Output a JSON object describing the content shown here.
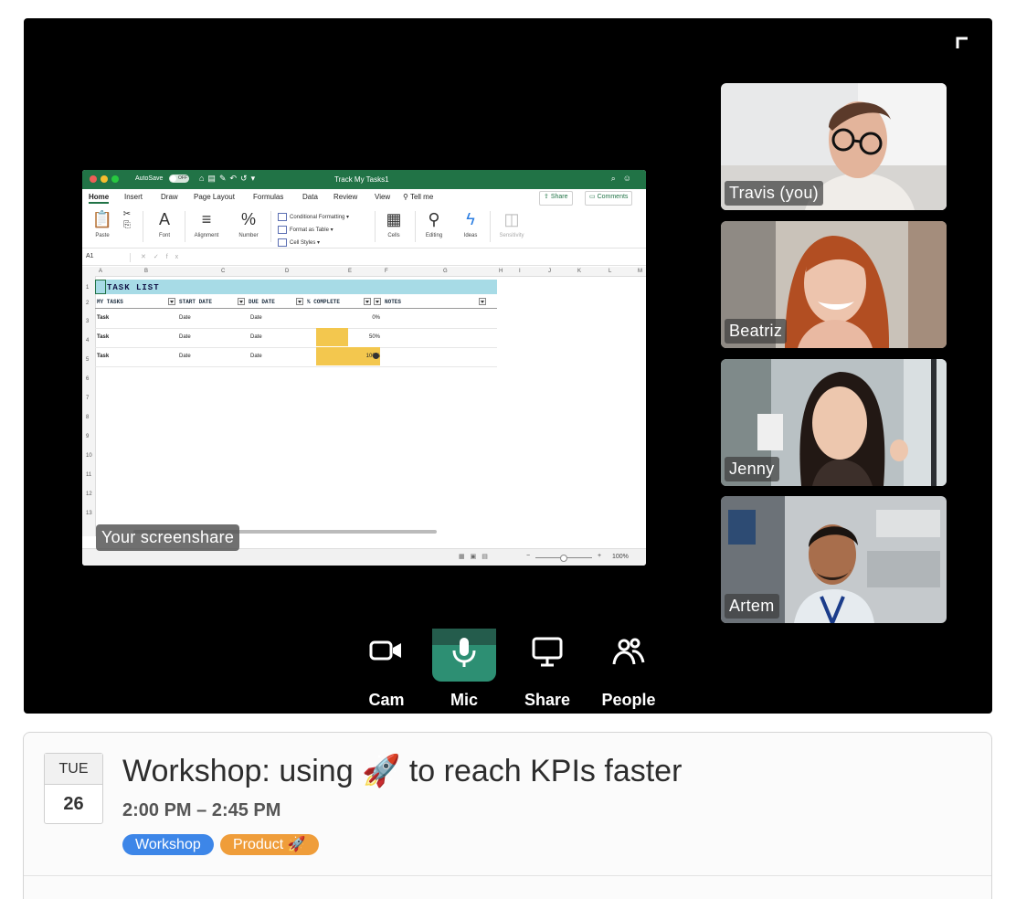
{
  "call": {
    "screenshare_label": "Your screenshare",
    "participants": [
      {
        "name": "Travis (you)"
      },
      {
        "name": "Beatriz"
      },
      {
        "name": "Jenny"
      },
      {
        "name": "Artem"
      }
    ],
    "controls": [
      {
        "label": "Cam",
        "icon": "camera-icon"
      },
      {
        "label": "Mic",
        "icon": "microphone-icon",
        "active": true
      },
      {
        "label": "Share",
        "icon": "monitor-icon"
      },
      {
        "label": "People",
        "icon": "people-icon"
      }
    ],
    "accent_color": "#2d8f73"
  },
  "excel": {
    "autosave": "AutoSave",
    "autosave_state": "OFF",
    "doc_title": "Track My Tasks1",
    "tabs": [
      "Home",
      "Insert",
      "Draw",
      "Page Layout",
      "Formulas",
      "Data",
      "Review",
      "View",
      "Tell me"
    ],
    "share_btn": "Share",
    "comments_btn": "Comments",
    "ribbon": {
      "paste": "Paste",
      "font": "Font",
      "alignment": "Alignment",
      "number": "Number",
      "conditional_formatting": "Conditional Formatting",
      "format_as_table": "Format as Table",
      "cell_styles": "Cell Styles",
      "cells": "Cells",
      "editing": "Editing",
      "ideas": "Ideas",
      "sensitivity": "Sensitivity"
    },
    "name_box": "A1",
    "columns": [
      "A",
      "B",
      "C",
      "D",
      "E",
      "F",
      "G",
      "H",
      "I",
      "J",
      "K",
      "L",
      "M"
    ],
    "rows": [
      "1",
      "2",
      "3",
      "4",
      "5",
      "6",
      "7",
      "8",
      "9",
      "10",
      "11",
      "12",
      "13"
    ],
    "sheet_title": "TASK LIST",
    "headers": [
      "MY TASKS",
      "START DATE",
      "DUE DATE",
      "% COMPLETE",
      "NOTES"
    ],
    "tasks": [
      {
        "task": "Task",
        "start": "Date",
        "due": "Date",
        "pct": "0%",
        "progress": 0
      },
      {
        "task": "Task",
        "start": "Date",
        "due": "Date",
        "pct": "50%",
        "progress": 0.5
      },
      {
        "task": "Task",
        "start": "Date",
        "due": "Date",
        "pct": "100%",
        "progress": 1.0
      }
    ],
    "zoom": "100%"
  },
  "event": {
    "dow": "TUE",
    "day": "26",
    "title": "Workshop: using 🚀 to reach KPIs faster",
    "time": "2:00 PM – 2:45 PM",
    "tags": [
      {
        "label": "Workshop",
        "color": "#3d86e8"
      },
      {
        "label": "Product 🚀",
        "color": "#ef9d3a"
      }
    ]
  }
}
